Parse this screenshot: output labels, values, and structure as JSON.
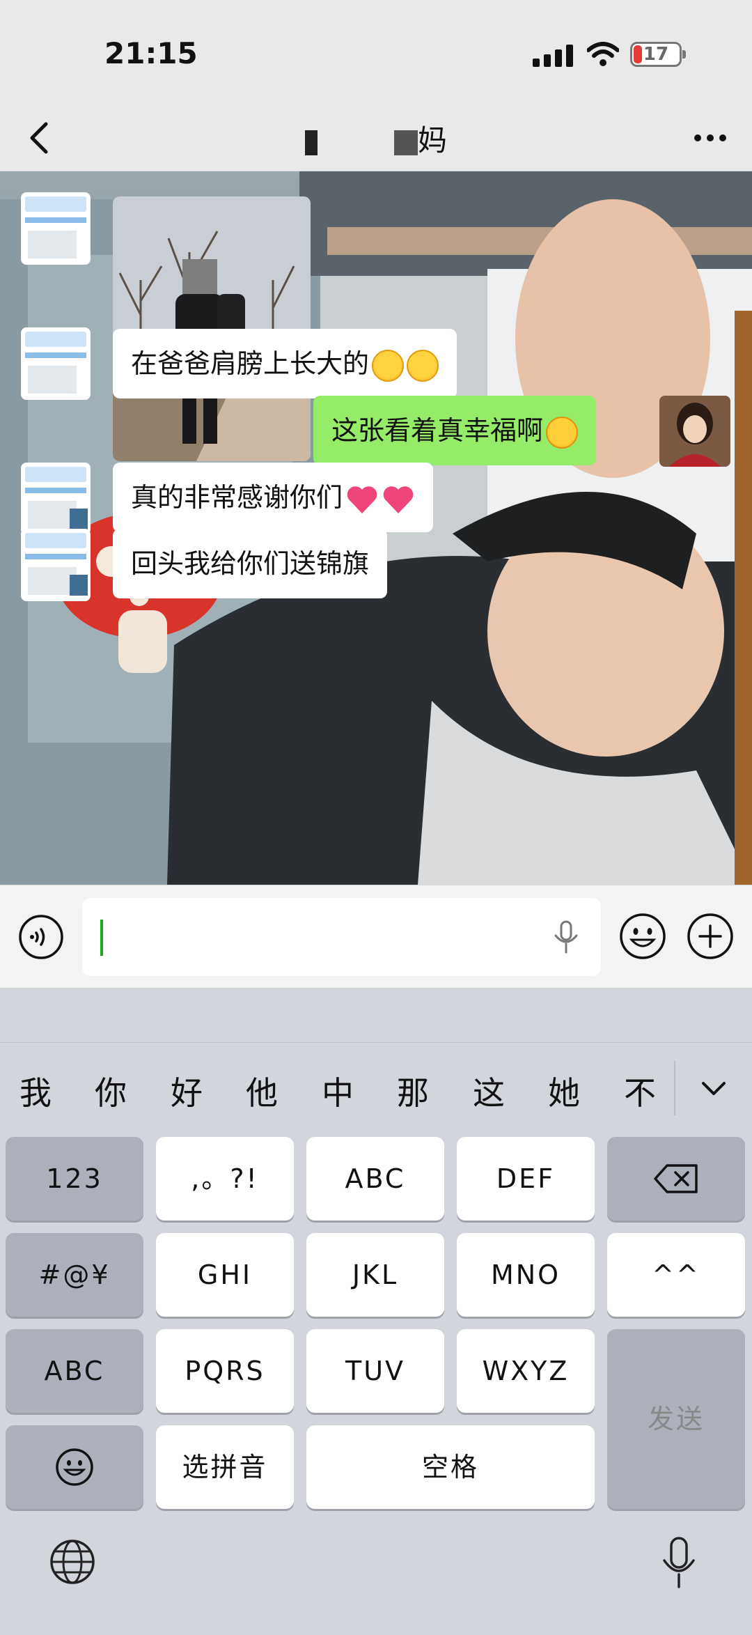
{
  "status_bar": {
    "time": "21:15",
    "battery": "17",
    "battery_color": "#e53935"
  },
  "header": {
    "title": "妈",
    "back_icon": "chevron-left-icon",
    "more_icon": "ellipsis-icon"
  },
  "chat": {
    "messages": [
      {
        "sender": "other",
        "type": "image"
      },
      {
        "sender": "other",
        "type": "text",
        "text": "在爸爸肩膀上长大的",
        "emoji": [
          "laughing-crying-emoji",
          "laughing-crying-emoji"
        ]
      },
      {
        "sender": "me",
        "type": "text",
        "text": "这张看着真幸福啊",
        "emoji": [
          "smiling-hearts-emoji"
        ]
      },
      {
        "sender": "other",
        "type": "text",
        "text": "真的非常感谢你们",
        "emoji": [
          "heart-emoji",
          "heart-emoji"
        ]
      },
      {
        "sender": "other",
        "type": "text",
        "text": "回头我给你们送锦旗",
        "emoji": []
      }
    ],
    "colors": {
      "my_bubble": "#95ec69",
      "other_bubble": "#ffffff"
    }
  },
  "input": {
    "value": "",
    "accent": "#1aad19"
  },
  "keyboard": {
    "candidates": [
      "我",
      "你",
      "好",
      "他",
      "中",
      "那",
      "这",
      "她",
      "不"
    ],
    "rows": [
      [
        "123",
        ",。?!",
        "ABC",
        "DEF",
        "backspace"
      ],
      [
        "#@¥",
        "GHI",
        "JKL",
        "MNO",
        "^^"
      ],
      [
        "ABC",
        "PQRS",
        "TUV",
        "WXYZ"
      ],
      [
        "emoji",
        "选拼音",
        "空格"
      ]
    ],
    "send_label": "发送"
  }
}
